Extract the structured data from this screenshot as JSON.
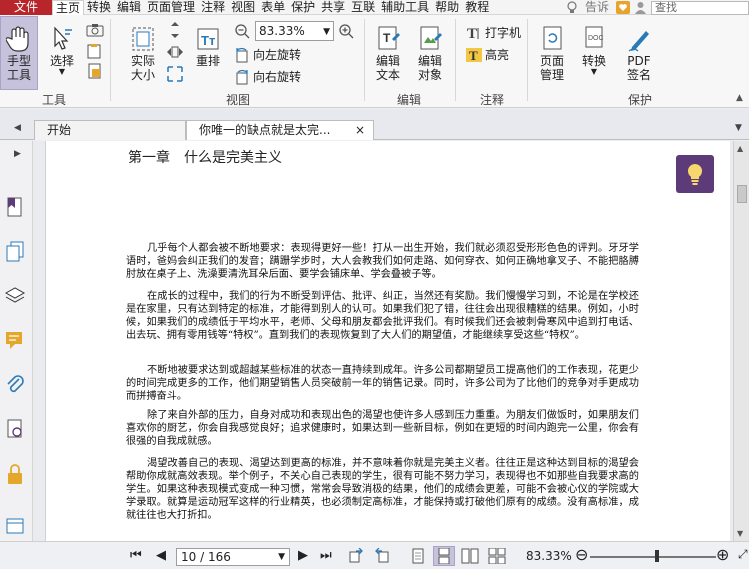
{
  "menubar": {
    "file": "文件",
    "items": [
      "主页",
      "转换",
      "编辑",
      "页面管理",
      "注释",
      "视图",
      "表单",
      "保护",
      "共享",
      "互联",
      "辅助工具",
      "帮助",
      "教程"
    ],
    "right_text": "告诉",
    "search_placeholder": "查找"
  },
  "ribbon": {
    "hand_tool": "手型\n工具",
    "select": "选择",
    "tools_group": "工具",
    "actual_size": "实际\n大小",
    "reflow": "重排",
    "zoom_value": "83.33%",
    "rotate_left": "向左旋转",
    "rotate_right": "向右旋转",
    "view_group": "视图",
    "edit_text": "编辑\n文本",
    "edit_object": "编辑\n对象",
    "edit_group": "编辑",
    "typewriter": "打字机",
    "highlight": "高亮",
    "comment_group": "注释",
    "page_manage": "页面\n管理",
    "convert": "转换",
    "pdf_sign": "PDF\n签名",
    "protect_group": "保护"
  },
  "tabs": {
    "start": "开始",
    "doc": "你唯一的缺点就是太完...",
    "close": "×"
  },
  "document": {
    "chapter": "第一章　什么是完美主义",
    "paragraphs": [
      "几乎每个人都会被不断地要求：表现得更好一些！打从一出生开始，我们就必须忍受形形色色的评判。牙牙学语时，爸妈会纠正我们的发音；蹒跚学步时，大人会教我们如何走路、如何穿衣、如何正确地拿叉子、不能把胳膊肘放在桌子上、洗澡要清洗耳朵后面、要学会铺床单、学会叠被子等。",
      "在成长的过程中，我们的行为不断受到评估、批评、纠正，当然还有奖励。我们慢慢学习到，不论是在学校还是在家里，只有达到特定的标准，才能得到别人的认可。如果我们犯了错，往往会出现很糟糕的结果。例如，小时候，如果我们的成绩低于平均水平，老师、父母和朋友都会批评我们。有时候我们还会被刺骨寒风中追到打电话、出去玩、拥有零用钱等“特权”。直到我们的表现恢复到了大人们的期望值，才能继续享受这些“特权”。",
      "不断地被要求达到或超越某些标准的状态一直持续到成年。许多公司都期望员工提高他们的工作表现，花更少的时间完成更多的工作，他们期望销售人员突破前一年的销售记录。同时，许多公司为了比他们的竞争对手更成功而拼搏奋斗。",
      "除了来自外部的压力，自身对成功和表现出色的渴望也使许多人感到压力重重。为朋友们做饭时，如果朋友们喜欢你的厨艺，你会自我感觉良好；追求健康时，如果达到一些新目标，例如在更短的时间内跑完一公里，你会有很强的自我成就感。",
      "渴望改善自己的表现、渴望达到更高的标准，并不意味着你就是完美主义者。往往正是这种达到目标的渴望会帮助你成就高效表现。举个例子，不关心自己表现的学生，很有可能不努力学习，表现得也不如那些自我要求高的学生。如果这种表现模式变成一种习惯，常常会导致消极的结果，他们的成绩会更差，可能不会被心仪的学院或大学录取。就算是运动冠军这样的行业精英，也必须制定高标准，才能保持或打破他们原有的成绩。没有高标准，成就往往也大打折扣。"
    ]
  },
  "statusbar": {
    "page": "10 / 166",
    "zoom": "83.33%"
  }
}
